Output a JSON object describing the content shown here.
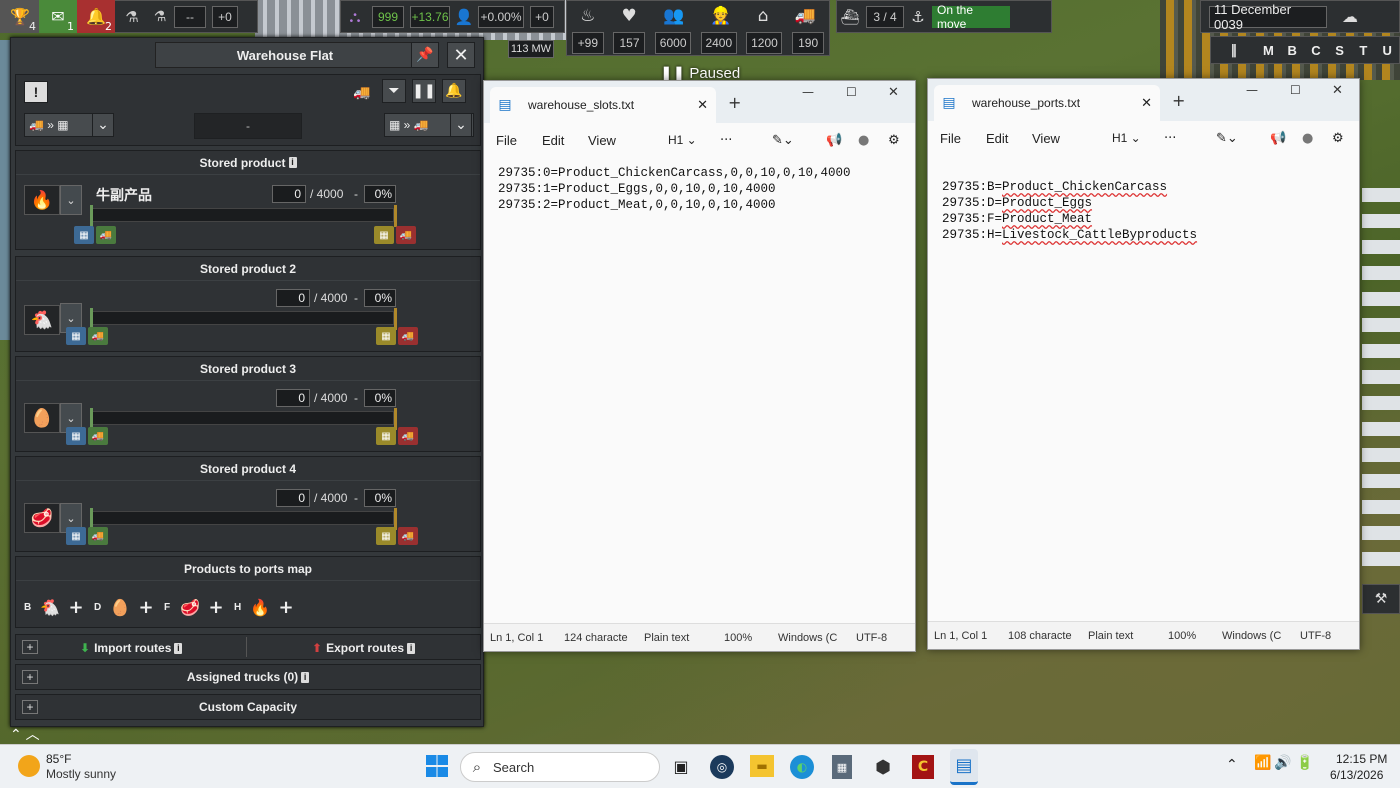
{
  "hud": {
    "trophy_count": "4",
    "mail_count": "1",
    "alert_count": "2",
    "research_value": "--",
    "research_delta": "+0",
    "power": "113 MW",
    "unity": "999",
    "unity_delta": "+13.76",
    "pop_growth": "+0.00%",
    "pop_delta": "+0",
    "paused": "Paused",
    "stats": [
      "+99",
      "157",
      "6000",
      "2400",
      "1200",
      "190"
    ],
    "ships": "3 / 4",
    "ship_status": "On the move",
    "date": "11 December 0039",
    "speed_letters": [
      "M",
      "B",
      "C",
      "S",
      "T",
      "U"
    ]
  },
  "warehouse": {
    "title": "Warehouse Flat",
    "center_field": "-",
    "slots": [
      {
        "title": "Stored product",
        "name": "牛副产品",
        "qty": "0",
        "cap": "/ 4000",
        "dash": "-",
        "pct": "0%",
        "icon": "cattle-byproducts-icon"
      },
      {
        "title": "Stored product 2",
        "name": "",
        "qty": "0",
        "cap": "/ 4000",
        "dash": "-",
        "pct": "0%",
        "icon": "chicken-carcass-icon"
      },
      {
        "title": "Stored product 3",
        "name": "",
        "qty": "0",
        "cap": "/ 4000",
        "dash": "-",
        "pct": "0%",
        "icon": "eggs-icon"
      },
      {
        "title": "Stored product 4",
        "name": "",
        "qty": "0",
        "cap": "/ 4000",
        "dash": "-",
        "pct": "0%",
        "icon": "meat-icon"
      }
    ],
    "ports_title": "Products to ports map",
    "ports": [
      {
        "port": "B",
        "icon": "chicken-carcass-icon"
      },
      {
        "port": "D",
        "icon": "eggs-icon"
      },
      {
        "port": "F",
        "icon": "meat-icon"
      },
      {
        "port": "H",
        "icon": "cattle-byproducts-icon"
      }
    ],
    "import_routes": "Import routes",
    "export_routes": "Export routes",
    "assigned_trucks": "Assigned trucks (0)",
    "custom_capacity": "Custom Capacity"
  },
  "notepad1": {
    "tab_title": "warehouse_slots.txt",
    "menu": [
      "File",
      "Edit",
      "View"
    ],
    "heading": "H1",
    "lines": [
      "29735:0=Product_ChickenCarcass,0,0,10,0,10,4000",
      "29735:1=Product_Eggs,0,0,10,0,10,4000",
      "29735:2=Product_Meat,0,0,10,0,10,4000"
    ],
    "status": {
      "pos": "Ln 1, Col 1",
      "chars": "124 characte",
      "type": "Plain text",
      "zoom": "100%",
      "eol": "Windows (C",
      "enc": "UTF-8"
    }
  },
  "notepad2": {
    "tab_title": "warehouse_ports.txt",
    "menu": [
      "File",
      "Edit",
      "View"
    ],
    "heading": "H1",
    "lines": [
      {
        "prefix": "29735:B=",
        "value": "Product_ChickenCarcass"
      },
      {
        "prefix": "29735:D=",
        "value": "Product_Eggs"
      },
      {
        "prefix": "29735:F=",
        "value": "Product_Meat"
      },
      {
        "prefix": "29735:H=",
        "value": "Livestock_CattleByproducts"
      }
    ],
    "status": {
      "pos": "Ln 1, Col 1",
      "chars": "108 characte",
      "type": "Plain text",
      "zoom": "100%",
      "eol": "Windows (C",
      "enc": "UTF-8"
    }
  },
  "taskbar": {
    "temp": "85°F",
    "weather": "Mostly sunny",
    "search_placeholder": "Search",
    "time": "12:15 PM",
    "date": "6/13/2026"
  }
}
